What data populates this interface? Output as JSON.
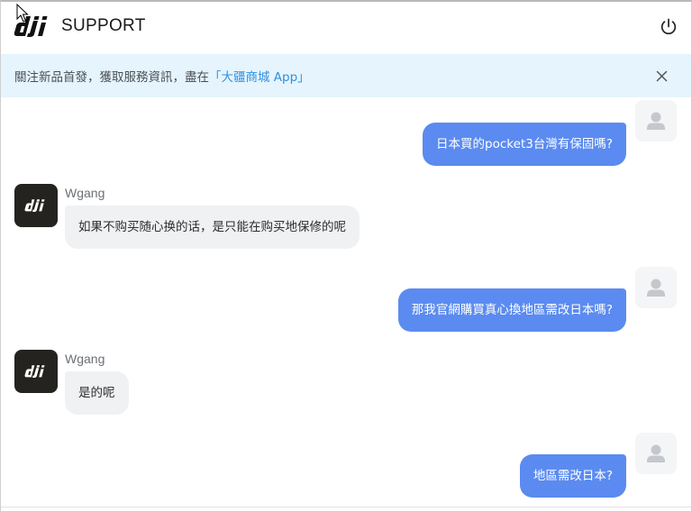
{
  "header": {
    "brand_text": "SUPPORT",
    "logo_icon": "dji-logo",
    "power_icon": "power-icon"
  },
  "notice": {
    "text": "關注新品首發，獲取服務資訊，盡在",
    "link_text": "「大疆商城 App」",
    "close_icon": "close-icon"
  },
  "messages": [
    {
      "role": "user",
      "text": "日本買的pocket3台灣有保固嗎?"
    },
    {
      "role": "agent",
      "name": "Wgang",
      "text": "如果不购买随心换的话，是只能在购买地保修的呢"
    },
    {
      "role": "user",
      "text": "那我官網購買真心換地區需改日本嗎?"
    },
    {
      "role": "agent",
      "name": "Wgang",
      "text": "是的呢"
    },
    {
      "role": "user",
      "text": "地區需改日本?"
    }
  ],
  "colors": {
    "user_bubble": "#5b8bf0",
    "agent_bubble": "#f0f1f3",
    "notice_bg": "#e5f4fd",
    "link": "#2f90e0",
    "agent_avatar": "#24231f"
  }
}
